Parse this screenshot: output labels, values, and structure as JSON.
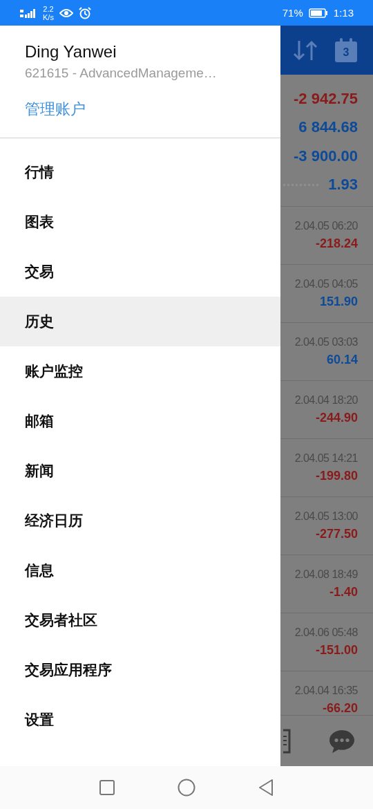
{
  "status_bar": {
    "speed_value": "2.2",
    "speed_unit": "K/s",
    "battery": "71%",
    "time": "1:13"
  },
  "drawer": {
    "user_name": "Ding Yanwei",
    "account": "621615 - AdvancedManageme…",
    "manage_link": "管理账户",
    "items": [
      {
        "label": "行情",
        "selected": false
      },
      {
        "label": "图表",
        "selected": false
      },
      {
        "label": "交易",
        "selected": false
      },
      {
        "label": "历史",
        "selected": true
      },
      {
        "label": "账户监控",
        "selected": false
      },
      {
        "label": "邮箱",
        "selected": false
      },
      {
        "label": "新闻",
        "selected": false
      },
      {
        "label": "经济日历",
        "selected": false
      },
      {
        "label": "信息",
        "selected": false
      },
      {
        "label": "交易者社区",
        "selected": false
      },
      {
        "label": "交易应用程序",
        "selected": false
      },
      {
        "label": "设置",
        "selected": false
      }
    ]
  },
  "background": {
    "calendar_day": "3",
    "summary": [
      {
        "value": "-2 942.75",
        "color": "#8b1a1a",
        "kind": "plain"
      },
      {
        "value": "6 844.68",
        "color": "#0d4a98",
        "kind": "plain"
      },
      {
        "value": "-3 900.00",
        "color": "#0d4a98",
        "kind": "plain"
      },
      {
        "value": "1.93",
        "color": "#0d4a98",
        "kind": "dotted"
      }
    ],
    "deals": [
      {
        "time": "2.04.05 06:20",
        "profit": "-218.24",
        "color": "#8b1a1a"
      },
      {
        "time": "2.04.05 04:05",
        "profit": "151.90",
        "color": "#0d4a98"
      },
      {
        "time": "2.04.05 03:03",
        "profit": "60.14",
        "color": "#0d4a98"
      },
      {
        "time": "2.04.04 18:20",
        "profit": "-244.90",
        "color": "#8b1a1a"
      },
      {
        "time": "2.04.05 14:21",
        "profit": "-199.80",
        "color": "#8b1a1a"
      },
      {
        "time": "2.04.05 13:00",
        "profit": "-277.50",
        "color": "#8b1a1a"
      },
      {
        "time": "2.04.08 18:49",
        "profit": "-1.40",
        "color": "#8b1a1a"
      },
      {
        "time": "2.04.06 05:48",
        "profit": "-151.00",
        "color": "#8b1a1a"
      },
      {
        "time": "2.04.04 16:35",
        "profit": "-66.20",
        "color": "#8b1a1a"
      }
    ]
  }
}
